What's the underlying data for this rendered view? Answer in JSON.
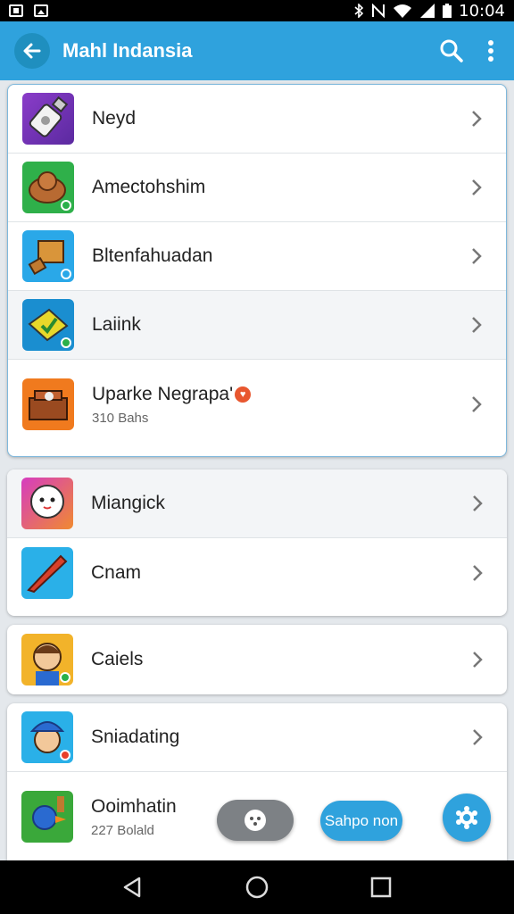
{
  "status_bar": {
    "time": "10:04"
  },
  "app_bar": {
    "title": "Mahl Indansia"
  },
  "lists": [
    {
      "items": [
        {
          "label": "Neyd",
          "icon": "usb-drive-icon"
        },
        {
          "label": "Amectohshim",
          "icon": "bread-icon"
        },
        {
          "label": "Bltenfahuadan",
          "icon": "box-tool-icon"
        },
        {
          "label": "Laiink",
          "icon": "green-check-icon"
        },
        {
          "label": "Uparke Negrapa'",
          "sublabel": "310 Bahs",
          "icon": "toolbox-icon"
        }
      ]
    },
    {
      "items": [
        {
          "label": "Miangick",
          "icon": "ghost-face-icon"
        },
        {
          "label": "Cnam",
          "icon": "red-knife-icon"
        }
      ]
    },
    {
      "items": [
        {
          "label": "Caiels",
          "icon": "character-face-icon"
        }
      ]
    },
    {
      "items": [
        {
          "label": "Sniadating",
          "icon": "cartoon-hat-icon"
        },
        {
          "label": "Ooimhatin",
          "sublabel": "227 Bolald",
          "icon": "bird-game-icon"
        }
      ]
    }
  ],
  "floating": {
    "pill_label": "Sahpo non"
  },
  "colors": {
    "accent": "#2fa2dd",
    "appbar": "#2fa2dd",
    "badge_green": "#2ab04a"
  }
}
